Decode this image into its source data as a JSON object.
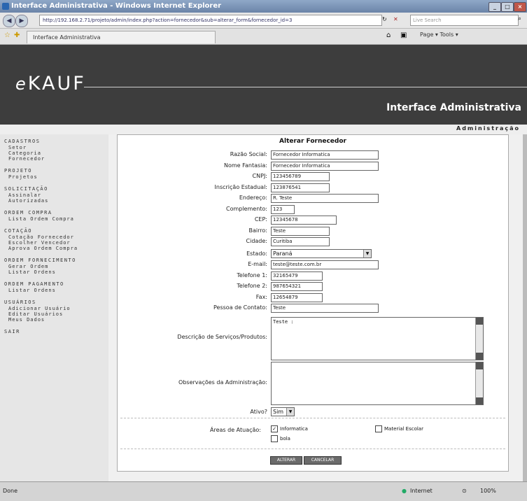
{
  "window": {
    "title": "Interface Administrativa - Windows Internet Explorer",
    "min": "_",
    "max": "□",
    "close": "×"
  },
  "browser": {
    "url": "http://192.168.2.71/projeto/admin/index.php?action=fornecedor&sub=alterar_form&fornecedor_id=3",
    "search_placeholder": "Live Search",
    "tab_title": "Interface Administrativa",
    "tools": "Page ▾  Tools ▾",
    "status_left": "Done",
    "status_zone": "Internet",
    "zoom": "100%"
  },
  "banner": {
    "logo_e": "e",
    "logo_rest": "KAUF",
    "subtitle": "Interface Administrativa",
    "admin_link": "Administração"
  },
  "sidebar": {
    "sections": [
      {
        "head": "CADASTROS",
        "items": [
          "Setor",
          "Categoria",
          "Fornecedor"
        ]
      },
      {
        "head": "PROJETO",
        "items": [
          "Projetos"
        ]
      },
      {
        "head": "SOLICITAÇÃO",
        "items": [
          "Assinalar",
          "Autorizadas"
        ]
      },
      {
        "head": "ORDEM COMPRA",
        "items": [
          "Lista Ordem Compra"
        ]
      },
      {
        "head": "COTAÇÃO",
        "items": [
          "Cotação Fornecedor",
          "Escolher Vencedor",
          "Aprova Ordem Compra"
        ]
      },
      {
        "head": "ORDEM FORNECIMENTO",
        "items": [
          "Gerar Ordem",
          "Listar Ordens"
        ]
      },
      {
        "head": "ORDEM PAGAMENTO",
        "items": [
          "Listar Ordens"
        ]
      },
      {
        "head": "USUÁRIOS",
        "items": [
          "Adicionar Usuário",
          "Editar Usuários",
          "Meus Dados"
        ]
      },
      {
        "head": "SAIR",
        "items": []
      }
    ]
  },
  "form": {
    "title": "Alterar Fornecedor",
    "fields": [
      {
        "label": "Razão Social:",
        "value": "Fornecedor Informatica"
      },
      {
        "label": "Nome Fantasia:",
        "value": "Fornecedor Informatica"
      },
      {
        "label": "CNPJ:",
        "value": "123456789"
      },
      {
        "label": "Inscrição Estadual:",
        "value": "123876541"
      },
      {
        "label": "Endereço:",
        "value": "R. Teste"
      },
      {
        "label": "Complemento:",
        "value": "123"
      },
      {
        "label": "CEP:",
        "value": "12345678"
      },
      {
        "label": "Bairro:",
        "value": "Teste"
      },
      {
        "label": "Cidade:",
        "value": "Curitiba"
      }
    ],
    "estado_label": "Estado:",
    "estado_value": "Paraná",
    "fields2": [
      {
        "label": "E-mail:",
        "value": "teste@teste.com.br"
      },
      {
        "label": "Telefone 1:",
        "value": "32165479"
      },
      {
        "label": "Telefone 2:",
        "value": "987654321"
      },
      {
        "label": "Fax:",
        "value": "12654879"
      },
      {
        "label": "Pessoa de Contato:",
        "value": "Teste"
      }
    ],
    "desc_label": "Descrição de Serviços/Produtos:",
    "desc_value": "Teste :",
    "obs_label": "Observações da Administração:",
    "obs_value": "",
    "ativo_label": "Ativo?",
    "ativo_value": "Sim",
    "areas_label": "Áreas de Atuação:",
    "areas": [
      {
        "label": "Informatica",
        "checked": true
      },
      {
        "label": "Material Escolar",
        "checked": false
      },
      {
        "label": "bola",
        "checked": false
      }
    ],
    "btn_alterar": "ALTERAR",
    "btn_cancelar": "CANCELAR"
  }
}
